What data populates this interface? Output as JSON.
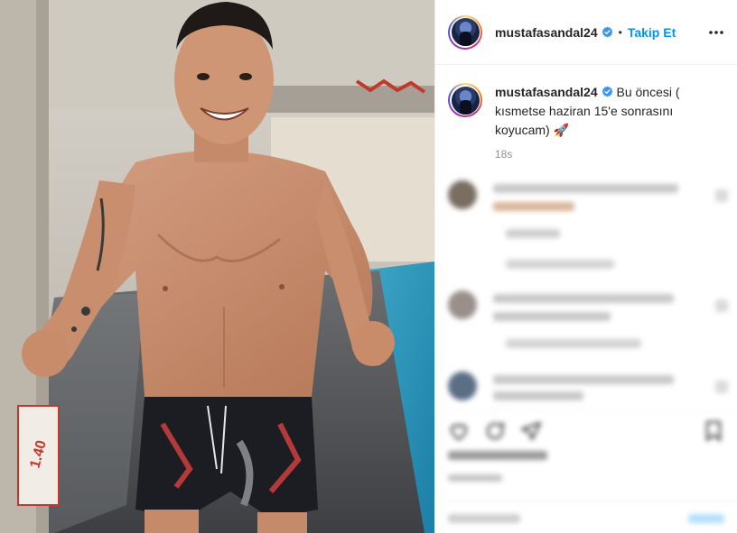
{
  "post": {
    "header": {
      "username": "mustafasandal24",
      "separator": "•",
      "follow_label": "Takip Et",
      "more_icon": "more-horizontal-icon",
      "verified_icon": "verified-badge-icon"
    },
    "caption": {
      "username": "mustafasandal24",
      "text": "Bu öncesi ( kısmetse haziran 15'e sonrasını koyucam) 🚀",
      "time": "18s"
    },
    "colors": {
      "accent": "#0095f6",
      "verified": "#3897f0",
      "muted": "#8e8e8e",
      "border": "#efefef"
    },
    "actions": {
      "like_icon": "heart-icon",
      "comment_icon": "comment-icon",
      "share_icon": "share-icon",
      "save_icon": "bookmark-icon"
    }
  }
}
